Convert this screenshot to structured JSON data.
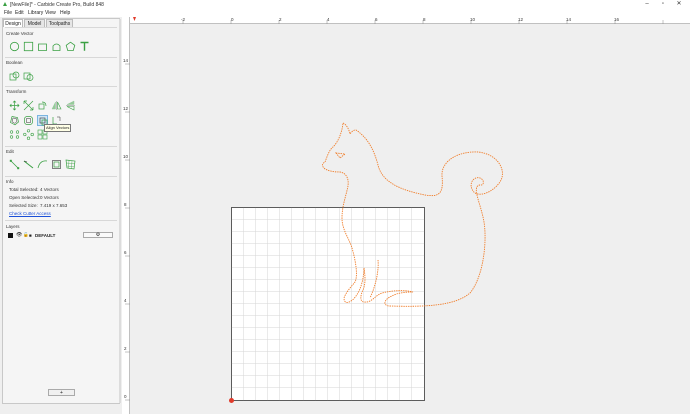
{
  "window": {
    "title": "[NewFile]* - Carbide Create Pro, Build 848"
  },
  "menu": [
    "File",
    "Edit",
    "Library",
    "View",
    "Help"
  ],
  "tabs": [
    "Design",
    "Model",
    "Toolpaths"
  ],
  "sections": {
    "create_vector": "Create Vector",
    "boolean": "Boolean",
    "transform": "Transform",
    "edit": "Edit",
    "info": "Info",
    "layers": "Layers"
  },
  "tools": {
    "create_vector": [
      "circle-icon",
      "square-icon",
      "polygon-icon",
      "arch-icon",
      "pentagon-icon",
      "text-icon"
    ],
    "boolean": [
      "union-icon",
      "subtract-icon"
    ],
    "transform_row1": [
      "move-icon",
      "scale-icon",
      "rotate-icon",
      "mirror-icon",
      "flip-icon"
    ],
    "transform_row2": [
      "offset-icon",
      "fillet-icon",
      "align-vectors-icon",
      "join-icon"
    ],
    "transform_row3": [
      "array-icon",
      "circular-array-icon",
      "group-icon"
    ],
    "edit": [
      "node-edit-icon",
      "knife-icon",
      "smooth-icon",
      "bounding-box-icon",
      "warp-icon"
    ]
  },
  "tooltip": "Align Vectors",
  "info": {
    "total_selected_label": "Total Selected:",
    "total_selected_value": "4 Vectors",
    "open_selected_label": "Open Selected:",
    "open_selected_value": "0 Vectors",
    "selected_size_label": "Selected Size:",
    "selected_size_value": "7.419 x 7.653",
    "check_cutter_access": "Check Cutter Access"
  },
  "layers": [
    {
      "name": "DEFAULT",
      "color": "#111111"
    }
  ],
  "add_layer_label": "+",
  "ruler": {
    "top": [
      "-2",
      "0",
      "2",
      "4",
      "6",
      "8",
      "10",
      "12",
      "14",
      "16"
    ],
    "left": [
      "14",
      "12",
      "10",
      "8",
      "6",
      "4",
      "2",
      "0"
    ]
  },
  "colors": {
    "accent": "#f07d2a",
    "tool_green": "#3aa043",
    "grid": "#d6d6d6"
  }
}
